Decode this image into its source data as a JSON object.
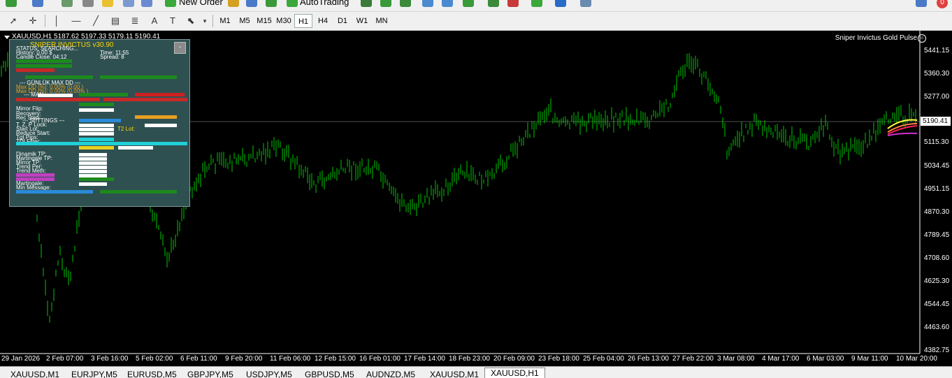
{
  "toolbar": {
    "new_order_label": "New Order",
    "autotrading_label": "AutoTrading",
    "notification_count": "0"
  },
  "timeframes": [
    "M1",
    "M5",
    "M15",
    "M30",
    "H1",
    "H4",
    "D1",
    "W1",
    "MN"
  ],
  "active_timeframe": "H1",
  "chart": {
    "title": "XAUUSD,H1  5187.62 5197.33 5179.11 5190.41",
    "indicator_name": "Sniper Invictus Gold Pulse",
    "current_price": "5190.41",
    "y_ticks": [
      "5441.15",
      "5360.30",
      "5277.00",
      "5190.41",
      "5115.30",
      "5034.45",
      "4951.15",
      "4870.30",
      "4789.45",
      "4708.60",
      "4625.30",
      "4544.45",
      "4463.60",
      "4382.75"
    ],
    "x_ticks": [
      "29 Jan 2026",
      "2 Feb 07:00",
      "3 Feb 16:00",
      "5 Feb 02:00",
      "6 Feb 11:00",
      "9 Feb 20:00",
      "11 Feb 06:00",
      "12 Feb 15:00",
      "16 Feb 01:00",
      "17 Feb 14:00",
      "18 Feb 23:00",
      "20 Feb 09:00",
      "23 Feb 18:00",
      "25 Feb 04:00",
      "26 Feb 13:00",
      "27 Feb 22:00",
      "3 Mar 08:00",
      "4 Mar 17:00",
      "6 Mar 03:00",
      "9 Mar 11:00",
      "10 Mar 20:00"
    ],
    "colors": {
      "candles": "#00c800",
      "background": "#000000",
      "price_line": "#a0a0a0"
    }
  },
  "panel": {
    "title": "SNIPER INVICTUS v30.90",
    "minimize_label": "-",
    "status": "STATUS: SEARCHING...",
    "history": "History: 0.00 $",
    "time": "Time: 11:55",
    "candle_close": "Candle Close: 04:12",
    "spread": "Spread: 8",
    "daily_dd_header": "--- GÜNLÜK MAX DD ---",
    "max_dd_1": "Max DD (%): 0.00% (0.00 )",
    "max_dd_2": "Max DD (%): 0.00% (0.00% )",
    "man_header": "--- MAN ---",
    "mirror_flip": "Mirror Flip:",
    "recovery": "Recovery:",
    "rec_step": "Rec Step:",
    "settings_header": "--- SETTINGS ---",
    "tzp_lock": "T. Z. P Lock:",
    "start_lot": "Start Lot:",
    "t2_lot": "T2 Lot:",
    "reduce_start": "Reduce Start:",
    "tgt_pips": "Tgt Pips:",
    "tdi_filter": "TDI Filter:",
    "dinamik_tp": "Dinamik TP:",
    "martingale_tp": "Martingale TP:",
    "mirror_tp": "Mirror TP:",
    "trend_per": "Trend Per:",
    "trend_meth": "Trend Meth:",
    "martingale": "Martingale:",
    "min_message": "Min Message:"
  },
  "tabs": [
    "XAUUSD,M1",
    "EURJPY,M5",
    "EURUSD,M5",
    "GBPJPY,M5",
    "USDJPY,M5",
    "GBPUSD,M5",
    "AUDNZD,M5",
    "XAUUSD,M1",
    "XAUUSD,H1"
  ],
  "active_tab": "XAUUSD,H1"
}
